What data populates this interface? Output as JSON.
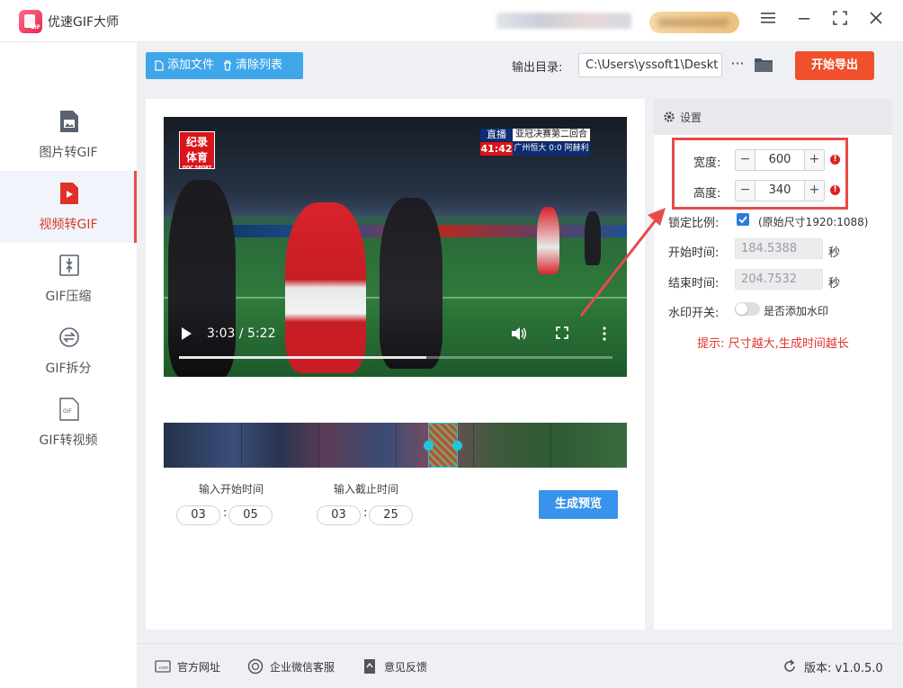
{
  "app": {
    "title": "优速GIF大师"
  },
  "sidebar": {
    "items": [
      {
        "label": "图片转GIF"
      },
      {
        "label": "视频转GIF"
      },
      {
        "label": "GIF压缩"
      },
      {
        "label": "GIF拆分"
      },
      {
        "label": "GIF转视频"
      }
    ],
    "active": "视频转GIF"
  },
  "toolbar": {
    "add_files": "添加文件",
    "clear_list": "清除列表",
    "output_label": "输出目录:",
    "output_path": "C:\\Users\\yssoft1\\Deskt",
    "more": "···",
    "start_export": "开始导出"
  },
  "video": {
    "corner_logo": "纪录",
    "corner_logo2": "体育",
    "corner_logo_small": "DOC SPORT",
    "live": "直播",
    "match_title": "亚冠决赛第二回合",
    "clock": "41:42",
    "score_line": "广州恒大 0:0 阿赫利",
    "time_display": "3:03 / 5:22",
    "progress_fraction": 0.57
  },
  "trim": {
    "start_label": "输入开始时间",
    "end_label": "输入截止时间",
    "start_min": "03",
    "start_sec": "05",
    "end_min": "03",
    "end_sec": "25",
    "colon": ":",
    "preview_button": "生成预览"
  },
  "settings": {
    "header": "设置",
    "width_label": "宽度:",
    "width_value": "600",
    "height_label": "高度:",
    "height_value": "340",
    "lock_label": "锁定比例:",
    "lock_checked": true,
    "original_size": "(原始尺寸1920:1088)",
    "start_time_label": "开始时间:",
    "start_time_value": "184.5388",
    "end_time_label": "结束时间:",
    "end_time_value": "204.7532",
    "seconds": "秒",
    "watermark_label": "水印开关:",
    "watermark_text": "是否添加水印",
    "watermark_on": false,
    "hint": "提示: 尺寸越大,生成时间越长",
    "minus": "−",
    "plus": "+",
    "warn": "!"
  },
  "footer": {
    "website": "官方网址",
    "wechat": "企业微信客服",
    "feedback": "意见反馈",
    "version": "版本: v1.0.5.0"
  },
  "colors": {
    "accent_blue": "#3fa6ea",
    "start_orange": "#f0502b",
    "active_red": "#d83a2b",
    "highlight_red": "#e84a4a"
  }
}
